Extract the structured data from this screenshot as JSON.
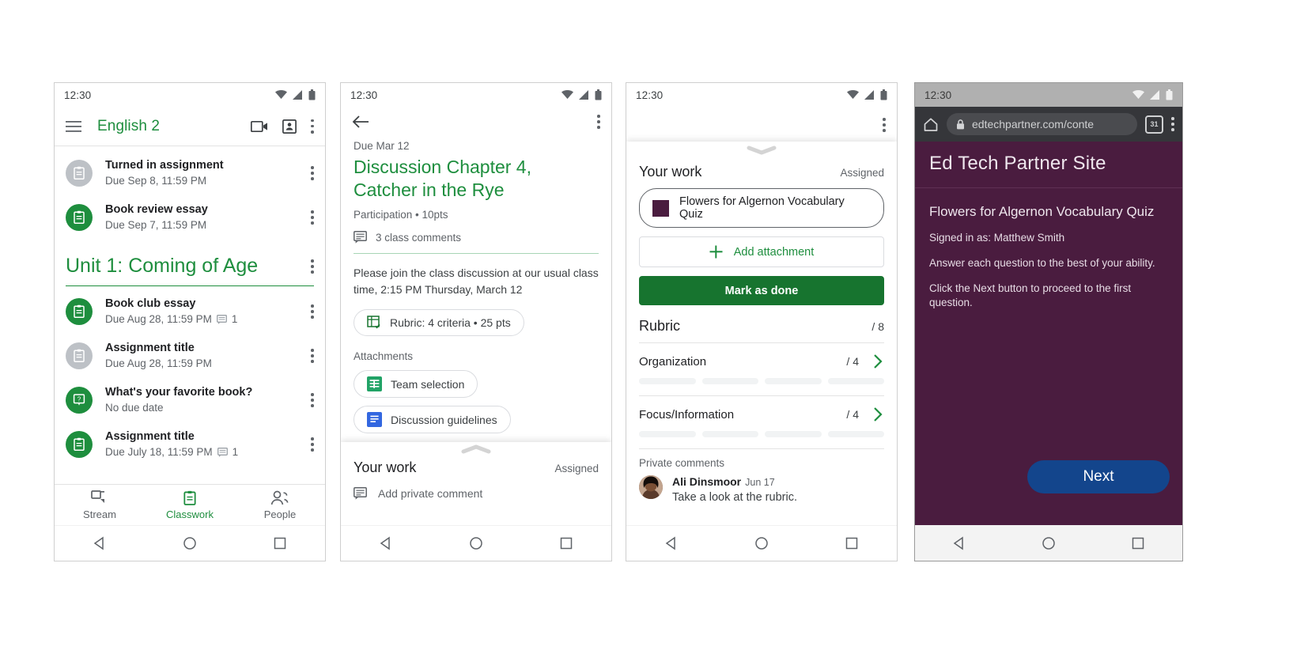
{
  "phone1": {
    "status": {
      "time": "12:30",
      "icons": [
        "wifi-icon",
        "signal-icon",
        "battery-icon"
      ]
    },
    "appbar": {
      "menu_icon": "hamburger-menu-icon",
      "title": "English 2",
      "meet_icon": "video-camera-icon",
      "card_icon": "class-card-icon",
      "overflow_icon": "overflow-menu-icon"
    },
    "top_items": [
      {
        "title": "Turned in assignment",
        "subtitle": "Due Sep 8, 11:59 PM",
        "icon": "assignment-icon",
        "state": "grey",
        "comments": ""
      },
      {
        "title": "Book review essay",
        "subtitle": "Due Sep 7, 11:59 PM",
        "icon": "assignment-icon",
        "state": "green",
        "comments": ""
      }
    ],
    "unit": {
      "title": "Unit 1: Coming of Age"
    },
    "unit_items": [
      {
        "title": "Book club essay",
        "subtitle": "Due Aug 28, 11:59 PM",
        "icon": "assignment-icon",
        "state": "green",
        "comments": "1"
      },
      {
        "title": "Assignment title",
        "subtitle": "Due Aug 28, 11:59 PM",
        "icon": "assignment-icon",
        "state": "grey",
        "comments": ""
      },
      {
        "title": "What's your favorite book?",
        "subtitle": "No due date",
        "icon": "question-icon",
        "state": "green",
        "comments": ""
      },
      {
        "title": "Assignment title",
        "subtitle": "Due July 18, 11:59 PM",
        "icon": "assignment-icon",
        "state": "green",
        "comments": "1"
      }
    ],
    "bottom_nav": [
      {
        "label": "Stream",
        "icon": "stream-icon",
        "active": false
      },
      {
        "label": "Classwork",
        "icon": "classwork-icon",
        "active": true
      },
      {
        "label": "People",
        "icon": "people-icon",
        "active": false
      }
    ]
  },
  "phone2": {
    "status": {
      "time": "12:30"
    },
    "back_icon": "back-arrow-icon",
    "overflow_icon": "overflow-menu-icon",
    "due": "Due Mar 12",
    "title": "Discussion Chapter 4, Catcher in the Rye",
    "meta": "Participation • 10pts",
    "class_comments": "3 class comments",
    "description": "Please join the class discussion at our usual class time, 2:15 PM Thursday, March 12",
    "rubric_chip": "Rubric: 4 criteria • 25 pts",
    "attachments_label": "Attachments",
    "attachments": [
      {
        "name": "Team selection",
        "icon": "google-sheets-icon"
      },
      {
        "name": "Discussion guidelines",
        "icon": "google-docs-icon"
      }
    ],
    "sheet": {
      "heading": "Your work",
      "status": "Assigned",
      "private_comment": "Add private comment"
    }
  },
  "phone3": {
    "status": {
      "time": "12:30"
    },
    "overflow_icon": "overflow-menu-icon",
    "sheet": {
      "heading": "Your work",
      "status": "Assigned"
    },
    "attachment": {
      "name": "Flowers for Algernon Vocabulary Quiz",
      "swatch_color": "#4a1c3f"
    },
    "add_attachment": "Add attachment",
    "mark_done": "Mark as done",
    "rubric": {
      "heading": "Rubric",
      "total": "/ 8"
    },
    "criteria": [
      {
        "name": "Organization",
        "points": "/ 4",
        "levels": 4
      },
      {
        "name": "Focus/Information",
        "points": "/ 4",
        "levels": 4
      }
    ],
    "private_comments_label": "Private comments",
    "comment": {
      "author": "Ali Dinsmoor",
      "date": "Jun 17",
      "body": "Take a look at the rubric."
    }
  },
  "phone4": {
    "status": {
      "time": "12:30"
    },
    "browser": {
      "home_icon": "home-icon",
      "lock_icon": "lock-icon",
      "url": "edtechpartner.com/conte",
      "tab_count": "31",
      "overflow_icon": "overflow-menu-icon"
    },
    "site": {
      "header": "Ed Tech Partner Site",
      "quiz_title": "Flowers for Algernon Vocabulary Quiz",
      "signed_in": "Signed in as: Matthew Smith",
      "line1": "Answer each question to the best of your ability.",
      "line2": "Click the Next button to proceed to the first question.",
      "next_button": "Next",
      "bg_color": "#4a1c3f",
      "button_color": "#13458c"
    }
  },
  "colors": {
    "green": "#1e8e3e",
    "dark_green": "#17742f",
    "grey": "#5f6368",
    "purple": "#4a1c3f",
    "blue": "#13458c"
  },
  "sysnav": {
    "back": "nav-back-icon",
    "home": "nav-home-icon",
    "recents": "nav-recents-icon"
  }
}
